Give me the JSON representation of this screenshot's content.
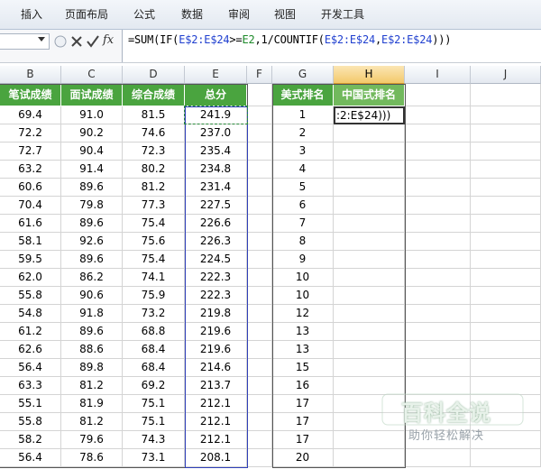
{
  "ribbon": {
    "tabs": [
      "插入",
      "页面布局",
      "公式",
      "数据",
      "审阅",
      "视图",
      "开发工具"
    ]
  },
  "formula_bar": {
    "cancel_icon": "close-icon",
    "enter_icon": "check-icon",
    "fx_label": "fx",
    "formula_parts": [
      {
        "text": "=SUM(IF(",
        "color": "black"
      },
      {
        "text": "E$2:E$24",
        "color": "blue"
      },
      {
        "text": ">=",
        "color": "black"
      },
      {
        "text": "E2",
        "color": "green"
      },
      {
        "text": ",1/COUNTIF(",
        "color": "black"
      },
      {
        "text": "E$2:E$24",
        "color": "blue"
      },
      {
        "text": ",",
        "color": "black"
      },
      {
        "text": "E$2:E$24",
        "color": "blue"
      },
      {
        "text": ")))",
        "color": "black"
      }
    ]
  },
  "columns": [
    "B",
    "C",
    "D",
    "E",
    "F",
    "G",
    "H",
    "I",
    "J"
  ],
  "headers": {
    "B": "笔试成绩",
    "C": "面试成绩",
    "D": "综合成绩",
    "E": "总分",
    "G": "美式排名",
    "H": "中国式排名"
  },
  "edit_cell_text": ":2:E$24)))",
  "rows": [
    {
      "B": "69.4",
      "C": "91.0",
      "D": "81.5",
      "E": "241.9",
      "G": "1"
    },
    {
      "B": "72.2",
      "C": "90.2",
      "D": "74.6",
      "E": "237.0",
      "G": "2"
    },
    {
      "B": "72.7",
      "C": "90.4",
      "D": "72.3",
      "E": "235.4",
      "G": "3"
    },
    {
      "B": "63.2",
      "C": "91.4",
      "D": "80.2",
      "E": "234.8",
      "G": "4"
    },
    {
      "B": "60.6",
      "C": "89.6",
      "D": "81.2",
      "E": "231.4",
      "G": "5"
    },
    {
      "B": "70.4",
      "C": "79.8",
      "D": "77.3",
      "E": "227.5",
      "G": "6"
    },
    {
      "B": "61.6",
      "C": "89.6",
      "D": "75.4",
      "E": "226.6",
      "G": "7"
    },
    {
      "B": "58.1",
      "C": "92.6",
      "D": "75.6",
      "E": "226.3",
      "G": "8"
    },
    {
      "B": "59.5",
      "C": "89.6",
      "D": "75.4",
      "E": "224.5",
      "G": "9"
    },
    {
      "B": "62.0",
      "C": "86.2",
      "D": "74.1",
      "E": "222.3",
      "G": "10"
    },
    {
      "B": "55.8",
      "C": "90.6",
      "D": "75.9",
      "E": "222.3",
      "G": "10"
    },
    {
      "B": "54.8",
      "C": "91.8",
      "D": "73.2",
      "E": "219.8",
      "G": "12"
    },
    {
      "B": "61.2",
      "C": "89.6",
      "D": "68.8",
      "E": "219.6",
      "G": "13"
    },
    {
      "B": "62.6",
      "C": "88.6",
      "D": "68.4",
      "E": "219.6",
      "G": "13"
    },
    {
      "B": "56.4",
      "C": "89.8",
      "D": "68.4",
      "E": "214.6",
      "G": "15"
    },
    {
      "B": "63.3",
      "C": "81.2",
      "D": "69.2",
      "E": "213.7",
      "G": "16"
    },
    {
      "B": "55.1",
      "C": "81.9",
      "D": "75.1",
      "E": "212.1",
      "G": "17"
    },
    {
      "B": "55.8",
      "C": "81.2",
      "D": "75.1",
      "E": "212.1",
      "G": "17"
    },
    {
      "B": "58.2",
      "C": "79.6",
      "D": "74.3",
      "E": "212.1",
      "G": "17"
    },
    {
      "B": "56.4",
      "C": "78.6",
      "D": "73.1",
      "E": "208.1",
      "G": "20"
    }
  ],
  "watermark": {
    "title": "百科全说",
    "subtitle": "助你轻松解决"
  },
  "colors": {
    "header_green": "#4aa43f",
    "header_green_light": "#72b95d",
    "formula_blue": "#1f3fcf",
    "formula_green": "#1d8a2a"
  }
}
